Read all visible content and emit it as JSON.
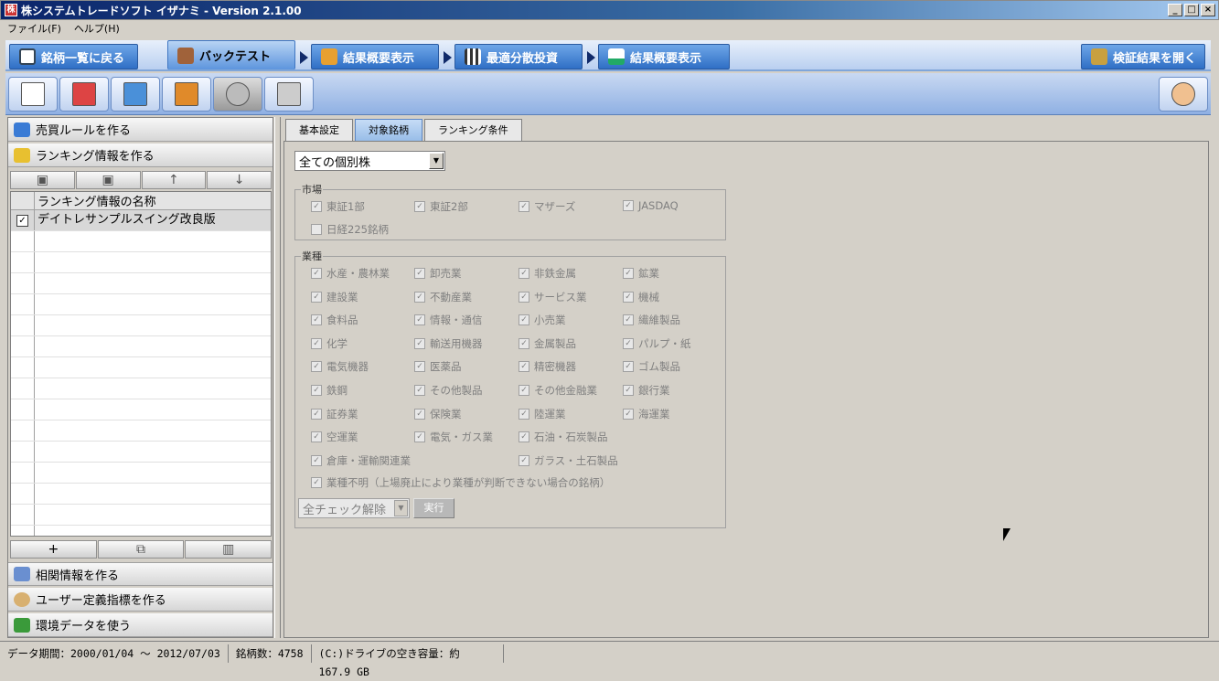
{
  "window": {
    "title": "株システムトレードソフト イザナミ - Version 2.1.00"
  },
  "menu": {
    "file": "ファイル(F)",
    "help": "ヘルプ(H)"
  },
  "nav": {
    "back": "銘柄一覧に戻る",
    "backtest": "バックテスト",
    "summary1": "結果概要表示",
    "optimize": "最適分散投資",
    "summary2": "結果概要表示",
    "open_results": "検証結果を開く"
  },
  "left": {
    "rules": "売買ルールを作る",
    "ranking": "ランキング情報を作る",
    "grid_header": "ランキング情報の名称",
    "rows": [
      "デイトレサンプルスイング改良版"
    ],
    "correlation": "相関情報を作る",
    "user_index": "ユーザー定義指標を作る",
    "env": "環境データを使う"
  },
  "tabs": {
    "basic": "基本設定",
    "target": "対象銘柄",
    "ranking": "ランキング条件"
  },
  "target": {
    "stock_type": "全ての個別株",
    "market_legend": "市場",
    "markets": [
      "東証1部",
      "東証2部",
      "マザーズ",
      "JASDAQ",
      "日経225銘柄"
    ],
    "industry_legend": "業種",
    "industries": [
      "水産・農林業",
      "卸売業",
      "非鉄金属",
      "鉱業",
      "建設業",
      "不動産業",
      "サービス業",
      "機械",
      "食料品",
      "情報・通信",
      "小売業",
      "繊維製品",
      "化学",
      "輸送用機器",
      "金属製品",
      "パルプ・紙",
      "電気機器",
      "医薬品",
      "精密機器",
      "ゴム製品",
      "鉄鋼",
      "その他製品",
      "その他金融業",
      "銀行業",
      "証券業",
      "保険業",
      "陸運業",
      "海運業",
      "空運業",
      "電気・ガス業",
      "石油・石炭製品",
      "倉庫・運輸関連業",
      "ガラス・土石製品"
    ],
    "unknown": "業種不明（上場廃止により業種が判断できない場合の銘柄）",
    "bulk_action": "全チェック解除",
    "run": "実行"
  },
  "status": {
    "period": "データ期間：2000/01/04 ～ 2012/07/03",
    "count": "銘柄数：4758",
    "disk": "(C:)ドライブの空き容量：約 167.9 GB"
  }
}
